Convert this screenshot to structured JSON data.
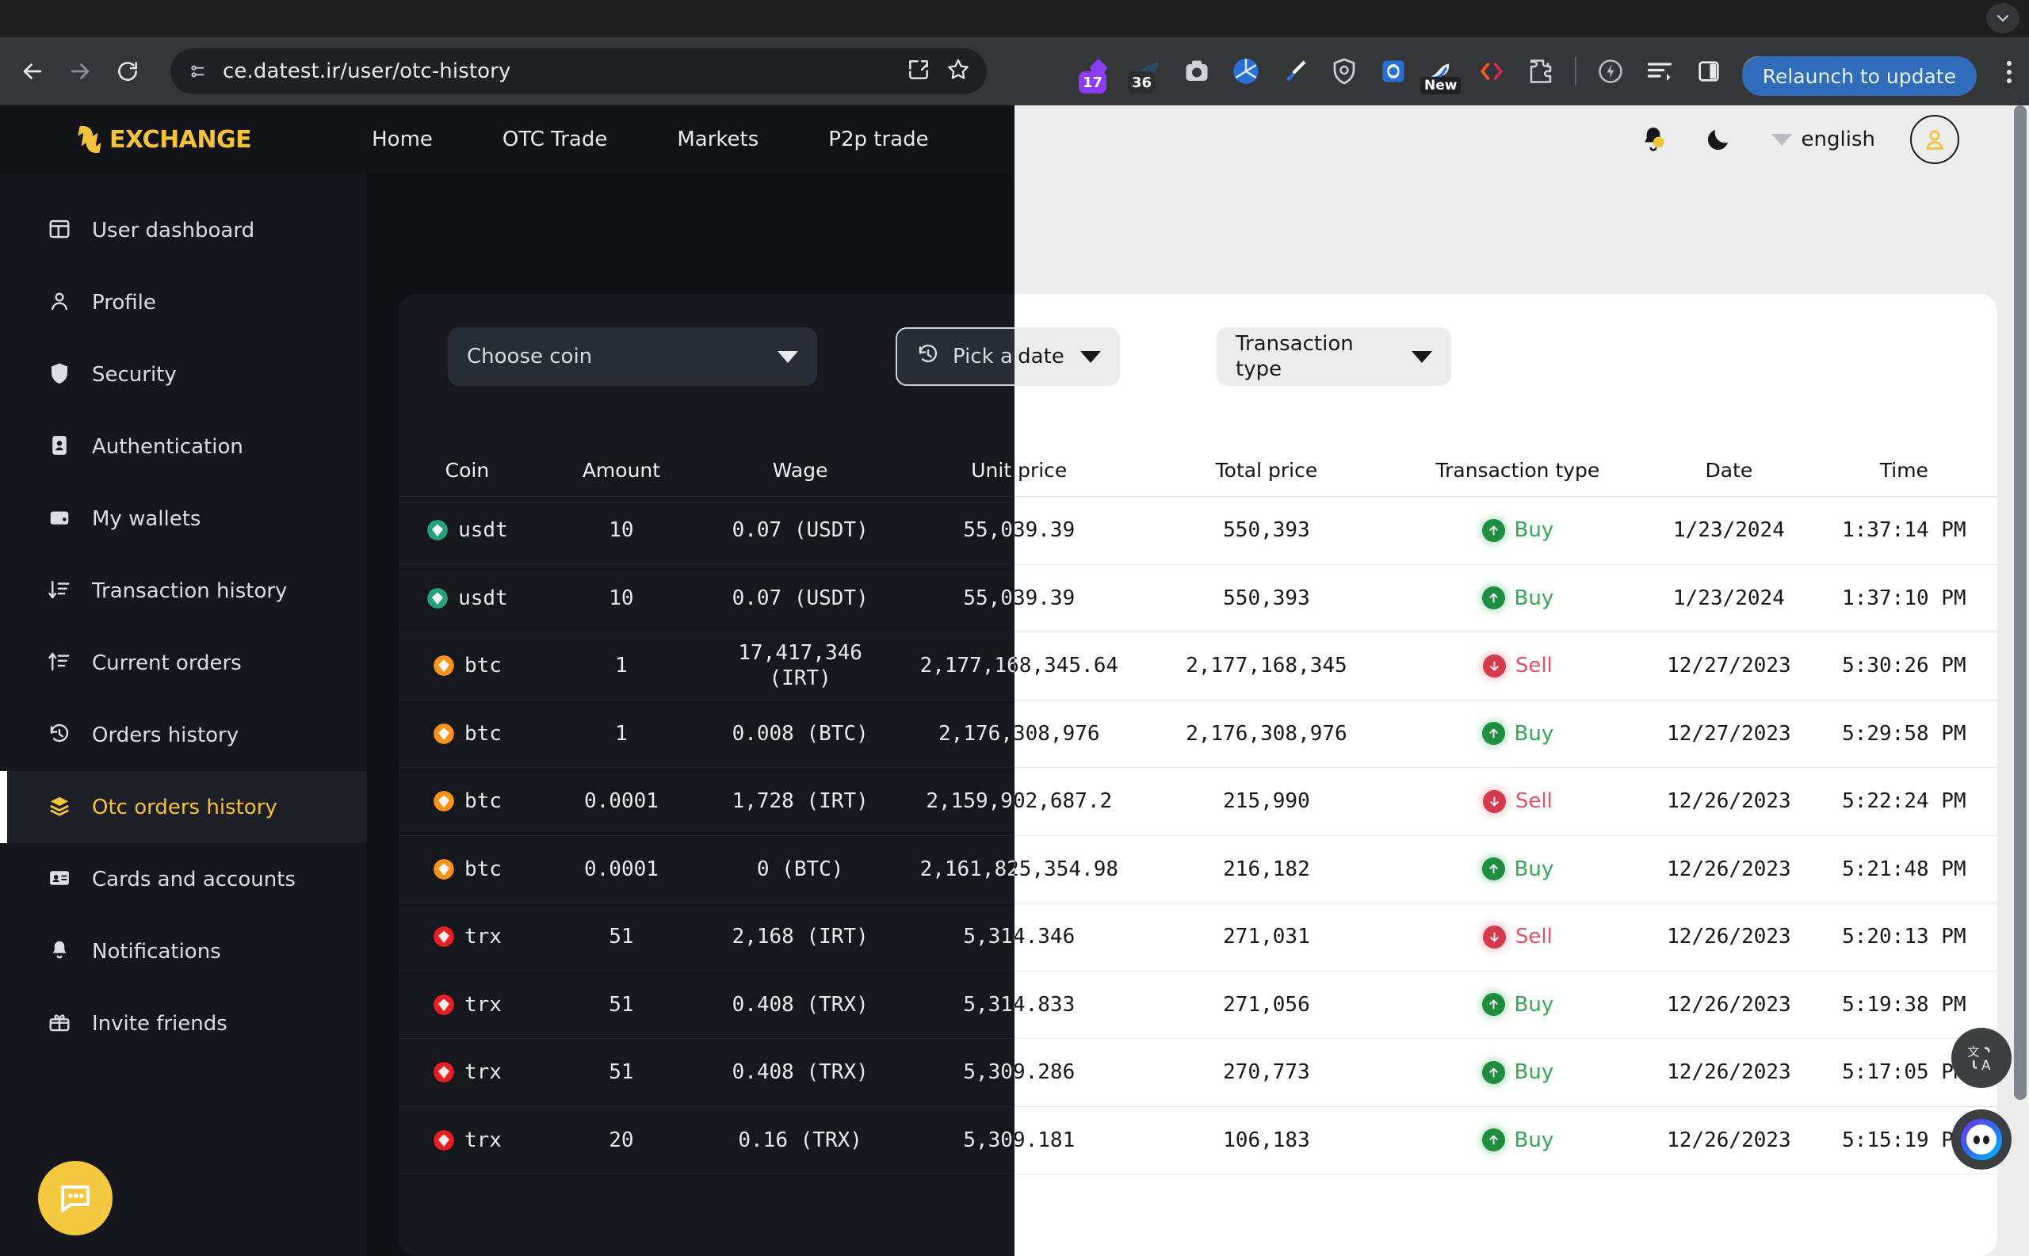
{
  "browser": {
    "url": "ce.datest.ir/user/otc-history",
    "back_label": "Back",
    "forward_label": "Forward",
    "reload_label": "Reload",
    "site_info_label": "View site information",
    "install_label": "Install app",
    "bookmark_label": "Bookmark this tab",
    "relaunch_label": "Relaunch to update",
    "menu_label": "Customize and control Chrome",
    "tab_search_label": "Search tabs",
    "extensions": [
      {
        "name": "grammar-extension",
        "badge": "17",
        "badge_color": "#8b3df5"
      },
      {
        "name": "tabs-extension",
        "badge": "36",
        "badge_color": "#2b2d31"
      },
      {
        "name": "camera-extension",
        "badge": ""
      },
      {
        "name": "aperture-extension",
        "badge": ""
      },
      {
        "name": "eyedropper-extension",
        "badge": ""
      },
      {
        "name": "shield-extension",
        "badge": ""
      },
      {
        "name": "capture-extension",
        "badge": ""
      },
      {
        "name": "screenshot-extension",
        "badge": "New"
      },
      {
        "name": "code-extension",
        "badge": ""
      },
      {
        "name": "puzzle-extensions",
        "badge": ""
      },
      {
        "name": "performance-extension",
        "badge": ""
      },
      {
        "name": "reading-list-extension",
        "badge": ""
      },
      {
        "name": "side-panel",
        "badge": ""
      },
      {
        "name": "profile-avatar",
        "badge": ""
      }
    ]
  },
  "site": {
    "logo_text": "EXCHANGE",
    "nav": [
      {
        "label": "Home"
      },
      {
        "label": "OTC Trade"
      },
      {
        "label": "Markets"
      },
      {
        "label": "P2p trade"
      }
    ],
    "language": "english",
    "notifications_label": "Notifications",
    "theme_toggle_label": "Dark mode",
    "account_label": "Account"
  },
  "sidebar": {
    "items": [
      {
        "label": "User dashboard",
        "icon": "dashboard-icon",
        "active": false
      },
      {
        "label": "Profile",
        "icon": "user-icon",
        "active": false
      },
      {
        "label": "Security",
        "icon": "shield-icon",
        "active": false
      },
      {
        "label": "Authentication",
        "icon": "id-card-icon",
        "active": false
      },
      {
        "label": "My wallets",
        "icon": "wallet-icon",
        "active": false
      },
      {
        "label": "Transaction history",
        "icon": "sort-desc-icon",
        "active": false
      },
      {
        "label": "Current orders",
        "icon": "sort-asc-icon",
        "active": false
      },
      {
        "label": "Orders history",
        "icon": "history-icon",
        "active": false
      },
      {
        "label": "Otc orders history",
        "icon": "layers-icon",
        "active": true
      },
      {
        "label": "Cards and accounts",
        "icon": "card-icon",
        "active": false
      },
      {
        "label": "Notifications",
        "icon": "bell-icon",
        "active": false
      },
      {
        "label": "Invite friends",
        "icon": "gift-icon",
        "active": false
      }
    ]
  },
  "filters": {
    "coin": "Choose coin",
    "date": "Pick a date",
    "type": "Transaction\ntype"
  },
  "table": {
    "headers": [
      "Coin",
      "Amount",
      "Wage",
      "Unit price",
      "Total price",
      "Transaction type",
      "Date",
      "Time"
    ],
    "rows": [
      {
        "coin": "usdt",
        "coin_color": "#26a17b",
        "amount": "10",
        "wage": "0.07 (USDT)",
        "unit_price": "55,039.39",
        "total_price": "550,393",
        "type": "Buy",
        "date": "1/23/2024",
        "time": "1:37:14 PM"
      },
      {
        "coin": "usdt",
        "coin_color": "#26a17b",
        "amount": "10",
        "wage": "0.07 (USDT)",
        "unit_price": "55,039.39",
        "total_price": "550,393",
        "type": "Buy",
        "date": "1/23/2024",
        "time": "1:37:10 PM"
      },
      {
        "coin": "btc",
        "coin_color": "#f7931a",
        "amount": "1",
        "wage": "17,417,346\n(IRT)",
        "unit_price": "2,177,168,345.64",
        "total_price": "2,177,168,345",
        "type": "Sell",
        "date": "12/27/2023",
        "time": "5:30:26 PM"
      },
      {
        "coin": "btc",
        "coin_color": "#f7931a",
        "amount": "1",
        "wage": "0.008 (BTC)",
        "unit_price": "2,176,308,976",
        "total_price": "2,176,308,976",
        "type": "Buy",
        "date": "12/27/2023",
        "time": "5:29:58 PM"
      },
      {
        "coin": "btc",
        "coin_color": "#f7931a",
        "amount": "0.0001",
        "wage": "1,728 (IRT)",
        "unit_price": "2,159,902,687.2",
        "total_price": "215,990",
        "type": "Sell",
        "date": "12/26/2023",
        "time": "5:22:24 PM"
      },
      {
        "coin": "btc",
        "coin_color": "#f7931a",
        "amount": "0.0001",
        "wage": "0 (BTC)",
        "unit_price": "2,161,825,354.98",
        "total_price": "216,182",
        "type": "Buy",
        "date": "12/26/2023",
        "time": "5:21:48 PM"
      },
      {
        "coin": "trx",
        "coin_color": "#e81e25",
        "amount": "51",
        "wage": "2,168 (IRT)",
        "unit_price": "5,314.346",
        "total_price": "271,031",
        "type": "Sell",
        "date": "12/26/2023",
        "time": "5:20:13 PM"
      },
      {
        "coin": "trx",
        "coin_color": "#e81e25",
        "amount": "51",
        "wage": "0.408 (TRX)",
        "unit_price": "5,314.833",
        "total_price": "271,056",
        "type": "Buy",
        "date": "12/26/2023",
        "time": "5:19:38 PM"
      },
      {
        "coin": "trx",
        "coin_color": "#e81e25",
        "amount": "51",
        "wage": "0.408 (TRX)",
        "unit_price": "5,309.286",
        "total_price": "270,773",
        "type": "Buy",
        "date": "12/26/2023",
        "time": "5:17:05 PM"
      },
      {
        "coin": "trx",
        "coin_color": "#e81e25",
        "amount": "20",
        "wage": "0.16 (TRX)",
        "unit_price": "5,309.181",
        "total_price": "106,183",
        "type": "Buy",
        "date": "12/26/2023",
        "time": "5:15:19 PM"
      }
    ]
  },
  "floating": {
    "chat_label": "Live chat",
    "translate_label": "Translate page",
    "assistant_label": "AI assistant"
  },
  "colors": {
    "brand_yellow": "#f5c33b",
    "buy_green": "#34a853",
    "sell_red": "#e05263",
    "accent_blue": "#2f6dbb"
  }
}
